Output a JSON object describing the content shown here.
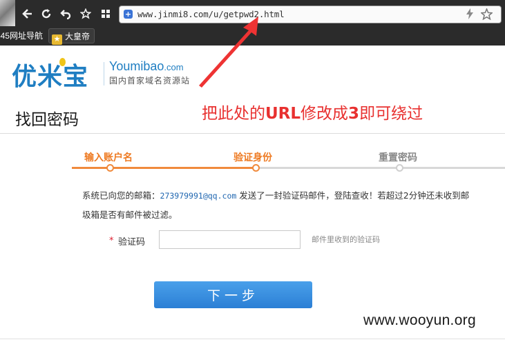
{
  "browser": {
    "url": "www.jinmi8.com/u/getpwd2.html",
    "nav_icons": [
      "back-icon",
      "reload-icon",
      "undo-icon",
      "bookmark-star-icon",
      "apps-icon"
    ],
    "omnibox_icons": [
      "lightning-icon",
      "star-icon"
    ],
    "bookmarks": [
      {
        "label": "345网址导航"
      },
      {
        "label": "大皇帝",
        "icon": "star-icon"
      }
    ]
  },
  "logo": {
    "cn": "优米宝",
    "en_main": "Youmibao",
    "en_suffix": ".com",
    "tagline": "国内首家域名资源站"
  },
  "page": {
    "title": "找回密码"
  },
  "annotation": {
    "text_before": "把此处的",
    "text_url": "URL",
    "text_mid": "修改成",
    "text_num": "3",
    "text_after": "即可绕过"
  },
  "steps": [
    {
      "label": "输入账户名",
      "state": "done"
    },
    {
      "label": "验证身份",
      "state": "current"
    },
    {
      "label": "重置密码",
      "state": "pending"
    }
  ],
  "message": {
    "part1": "系统已向您的邮箱：",
    "email": "273979991@qq.com",
    "part2": " 发送了一封验证码邮件，登陆查收！若超过2分钟还未收到邮",
    "line2": "圾箱是否有邮件被过滤。"
  },
  "form": {
    "required_mark": "*",
    "code_label": "验证码",
    "code_value": "",
    "code_hint": "邮件里收到的验证码",
    "next_button": "下一步"
  },
  "watermark": "www.wooyun.org",
  "colors": {
    "brand_blue": "#1f7ec2",
    "step_orange": "#ee7a22",
    "annotation_red": "#e8302f",
    "button_blue": "#2b7fd5"
  }
}
